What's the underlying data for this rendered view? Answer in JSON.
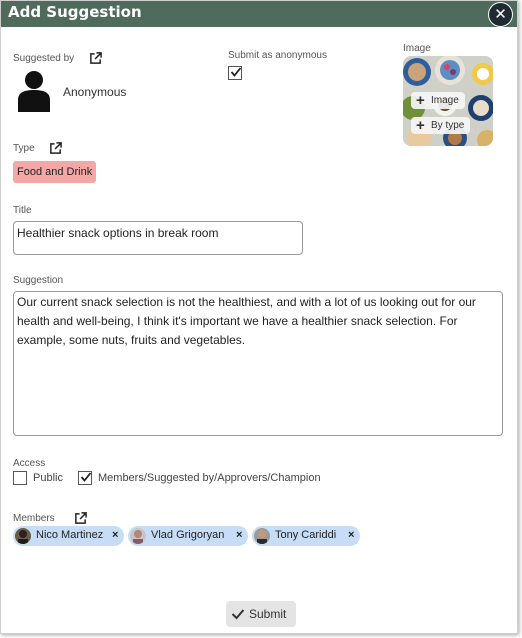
{
  "header": {
    "title": "Add Suggestion",
    "close_icon": "close-icon"
  },
  "suggested_by": {
    "label": "Suggested by",
    "name": "Anonymous"
  },
  "anonymous": {
    "label": "Submit as anonymous",
    "checked": true
  },
  "image": {
    "label": "Image",
    "add_image_label": "Image",
    "by_type_label": "By type"
  },
  "type": {
    "label": "Type",
    "value": "Food and Drink",
    "color": "#f3a7a7"
  },
  "title_field": {
    "label": "Title",
    "value": "Healthier snack options in break room"
  },
  "suggestion": {
    "label": "Suggestion",
    "value": "Our current snack selection is not the healthiest, and with a lot of us looking out for our health and well-being, I think it's important we have a healthier snack selection. For example, some nuts, fruits and vegetables."
  },
  "access": {
    "label": "Access",
    "public_label": "Public",
    "public_checked": false,
    "members_label": "Members/Suggested by/Approvers/Champion",
    "members_checked": true
  },
  "members": {
    "label": "Members",
    "items": [
      {
        "name": "Nico Martinez"
      },
      {
        "name": "Vlad Grigoryan"
      },
      {
        "name": "Tony Cariddi"
      }
    ]
  },
  "submit": {
    "label": "Submit"
  },
  "colors": {
    "header": "#4f6b5c",
    "chip": "#c7ddf6"
  }
}
